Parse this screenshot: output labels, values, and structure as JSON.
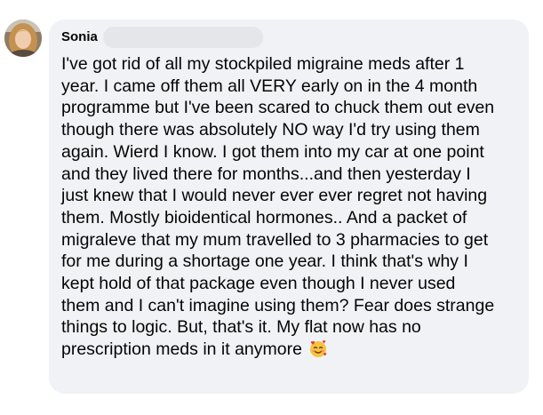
{
  "comment": {
    "author": "Sonia",
    "text": "I've got rid of all my stockpiled migraine meds after 1\nyear. I came off them all VERY early on in the 4 month\nprogramme but I've been scared to chuck them out even\nthough there was absolutely NO way I'd try using them\nagain. Wierd I know. I got them into my car at one point\nand they lived there for months...and then yesterday I\njust knew that I would never ever ever regret not having\nthem. Mostly bioidentical hormones.. And a packet of\nmigraleve that my mum travelled to 3 pharmacies to get\nfor me during a shortage one year. I think that's why I\nkept hold of that package even though I never used\nthem and I can't imagine using them? Fear does strange\nthings to logic. But, that's it. My flat now has no\nprescription meds in it anymore",
    "emoji_icon": "smiling-face-with-hearts-icon"
  },
  "colors": {
    "bubble_bg": "#f0f2f5",
    "text": "#050505",
    "redaction": "#e4e6e9"
  }
}
